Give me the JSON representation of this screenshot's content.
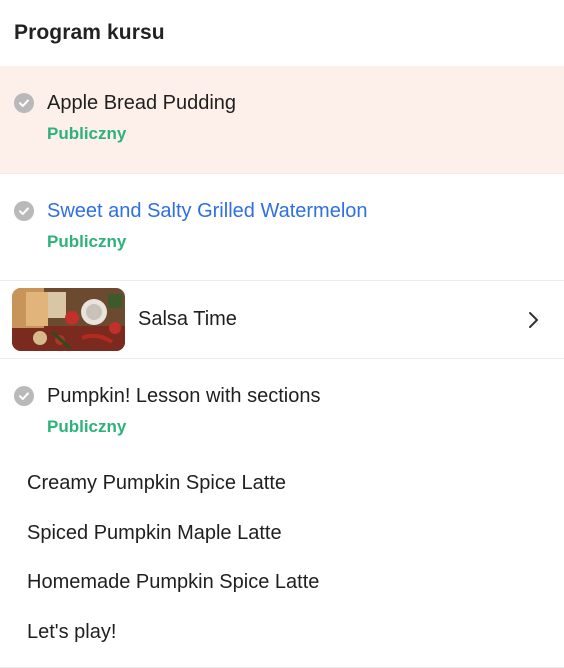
{
  "header": {
    "title": "Program kursu"
  },
  "lessons": [
    {
      "title": "Apple Bread Pudding",
      "status": "Publiczny"
    },
    {
      "title": "Sweet and Salty Grilled Watermelon",
      "status": "Publiczny"
    },
    {
      "title": "Salsa Time"
    },
    {
      "title": "Pumpkin! Lesson with sections",
      "status": "Publiczny",
      "sections": [
        "Creamy Pumpkin Spice Latte",
        "Spiced Pumpkin Maple Latte",
        "Homemade Pumpkin Spice Latte",
        "Let's play!"
      ]
    }
  ],
  "colors": {
    "active_bg": "#fdf0ea",
    "status": "#2db27a",
    "link": "#2f6fe4",
    "check": "#b9b9b9"
  },
  "icons": {
    "completed": "check-circle-icon",
    "next": "chevron-right-icon"
  }
}
